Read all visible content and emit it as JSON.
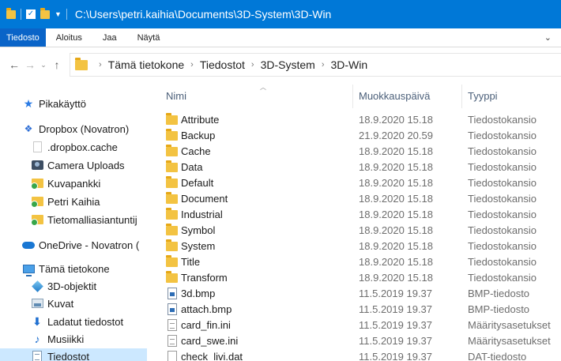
{
  "window": {
    "title": "C:\\Users\\petri.kaihia\\Documents\\3D-System\\3D-Win"
  },
  "ribbon": {
    "tabs": [
      "Tiedosto",
      "Aloitus",
      "Jaa",
      "Näytä"
    ]
  },
  "address": {
    "crumbs": [
      "Tämä tietokone",
      "Tiedostot",
      "3D-System",
      "3D-Win"
    ]
  },
  "navpane": {
    "items": [
      {
        "label": "Pikakäyttö",
        "icon": "star-icon"
      },
      {
        "label": "Dropbox (Novatron)",
        "icon": "dropbox-icon"
      },
      {
        "label": ".dropbox.cache",
        "icon": "blank-folder-icon"
      },
      {
        "label": "Camera Uploads",
        "icon": "camera-icon"
      },
      {
        "label": "Kuvapankki",
        "icon": "synced-folder-icon"
      },
      {
        "label": "Petri Kaihia",
        "icon": "synced-folder-icon"
      },
      {
        "label": "Tietomalliasiantuntij",
        "icon": "synced-folder-icon"
      },
      {
        "label": "OneDrive - Novatron (",
        "icon": "cloud-icon"
      },
      {
        "label": "Tämä tietokone",
        "icon": "computer-icon"
      },
      {
        "label": "3D-objektit",
        "icon": "cube-icon"
      },
      {
        "label": "Kuvat",
        "icon": "pictures-icon"
      },
      {
        "label": "Ladatut tiedostot",
        "icon": "download-icon"
      },
      {
        "label": "Musiikki",
        "icon": "music-icon"
      },
      {
        "label": "Tiedostot",
        "icon": "documents-icon"
      }
    ]
  },
  "columns": {
    "name": "Nimi",
    "modified": "Muokkauspäivä",
    "type": "Tyyppi"
  },
  "files": [
    {
      "name": "Attribute",
      "date": "18.9.2020 15.18",
      "type": "Tiedostokansio",
      "icon": "folder-icon"
    },
    {
      "name": "Backup",
      "date": "21.9.2020 20.59",
      "type": "Tiedostokansio",
      "icon": "folder-icon"
    },
    {
      "name": "Cache",
      "date": "18.9.2020 15.18",
      "type": "Tiedostokansio",
      "icon": "folder-icon"
    },
    {
      "name": "Data",
      "date": "18.9.2020 15.18",
      "type": "Tiedostokansio",
      "icon": "folder-icon"
    },
    {
      "name": "Default",
      "date": "18.9.2020 15.18",
      "type": "Tiedostokansio",
      "icon": "folder-icon"
    },
    {
      "name": "Document",
      "date": "18.9.2020 15.18",
      "type": "Tiedostokansio",
      "icon": "folder-icon"
    },
    {
      "name": "Industrial",
      "date": "18.9.2020 15.18",
      "type": "Tiedostokansio",
      "icon": "folder-icon"
    },
    {
      "name": "Symbol",
      "date": "18.9.2020 15.18",
      "type": "Tiedostokansio",
      "icon": "folder-icon"
    },
    {
      "name": "System",
      "date": "18.9.2020 15.18",
      "type": "Tiedostokansio",
      "icon": "folder-icon"
    },
    {
      "name": "Title",
      "date": "18.9.2020 15.18",
      "type": "Tiedostokansio",
      "icon": "folder-icon"
    },
    {
      "name": "Transform",
      "date": "18.9.2020 15.18",
      "type": "Tiedostokansio",
      "icon": "folder-icon"
    },
    {
      "name": "3d.bmp",
      "date": "11.5.2019 19.37",
      "type": "BMP-tiedosto",
      "icon": "bmp-file-icon"
    },
    {
      "name": "attach.bmp",
      "date": "11.5.2019 19.37",
      "type": "BMP-tiedosto",
      "icon": "bmp-file-icon"
    },
    {
      "name": "card_fin.ini",
      "date": "11.5.2019 19.37",
      "type": "Määritysasetukset",
      "icon": "ini-file-icon"
    },
    {
      "name": "card_swe.ini",
      "date": "11.5.2019 19.37",
      "type": "Määritysasetukset",
      "icon": "ini-file-icon"
    },
    {
      "name": "check_livi.dat",
      "date": "11.5.2019 19.37",
      "type": "DAT-tiedosto",
      "icon": "dat-file-icon"
    }
  ],
  "colors": {
    "titlebar": "#0078d7",
    "file_tab": "#0a64c8",
    "selected": "#cce8ff",
    "folder": "#f3c342"
  }
}
